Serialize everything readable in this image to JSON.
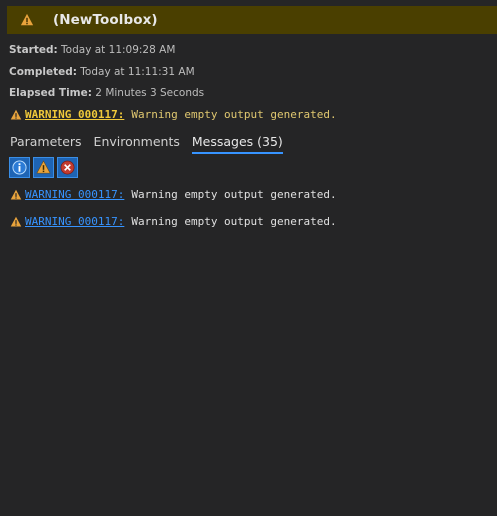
{
  "header": {
    "title": "(NewToolbox)",
    "icon": "warning-icon",
    "background": "#4a3f00"
  },
  "meta": {
    "started_label": "Started:",
    "started_value": "Today at 11:09:28 AM",
    "completed_label": "Completed:",
    "completed_value": "Today at 11:11:31 AM",
    "elapsed_label": "Elapsed Time:",
    "elapsed_value": "2 Minutes 3 Seconds"
  },
  "summary": {
    "code": "WARNING 000117:",
    "message": "Warning empty output generated."
  },
  "tabs": [
    {
      "label": "Parameters",
      "active": false
    },
    {
      "label": "Environments",
      "active": false
    },
    {
      "label": "Messages (35)",
      "active": true
    }
  ],
  "filters": [
    {
      "name": "info-filter",
      "icon": "info-icon"
    },
    {
      "name": "warning-filter",
      "icon": "warning-icon"
    },
    {
      "name": "error-filter",
      "icon": "error-icon"
    }
  ],
  "messages": [
    {
      "code": "WARNING 000117:",
      "text": "Warning empty output generated."
    },
    {
      "code": "WARNING 000117:",
      "text": "Warning empty output generated."
    }
  ],
  "colors": {
    "accent": "#3794ff",
    "warning": "#e8a33c",
    "link": "#3794ff"
  }
}
